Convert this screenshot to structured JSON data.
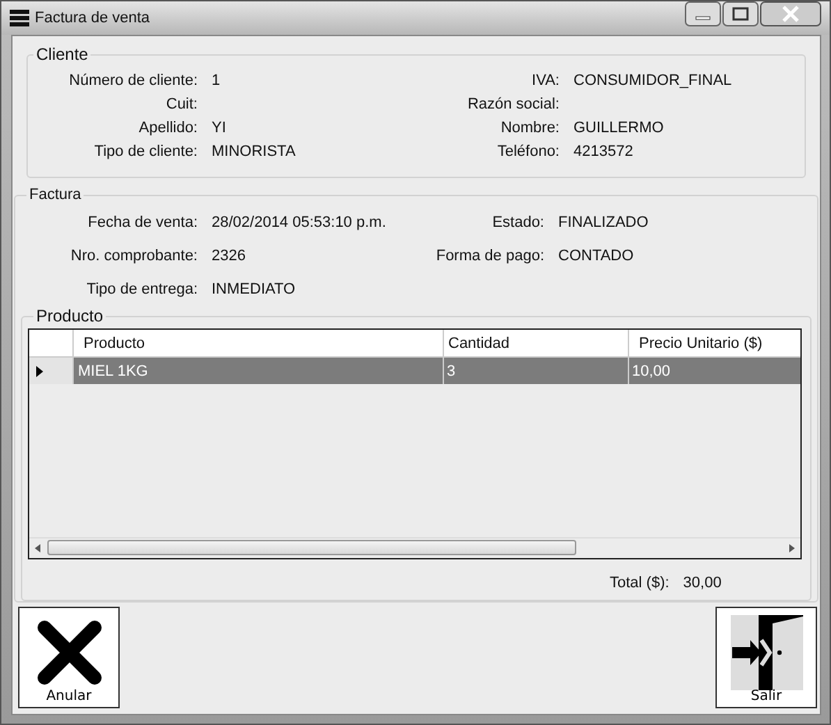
{
  "window": {
    "title": "Factura de venta"
  },
  "cliente": {
    "title": "Cliente",
    "left": [
      {
        "label": "Número de cliente:",
        "value": "1"
      },
      {
        "label": "Cuit:"
      },
      {
        "label": "Apellido:",
        "value": "YI"
      },
      {
        "label": "Tipo de cliente:",
        "value": "MINORISTA"
      }
    ],
    "right": [
      {
        "label": "IVA:",
        "value": "CONSUMIDOR_FINAL"
      },
      {
        "label": "Razón social:"
      },
      {
        "label": "Nombre:",
        "value": "GUILLERMO"
      },
      {
        "label": "Teléfono:",
        "value": "4213572"
      }
    ]
  },
  "factura": {
    "title": "Factura",
    "left": [
      {
        "label": "Fecha de venta:",
        "value": "28/02/2014 05:53:10 p.m."
      },
      {
        "label": "Nro. comprobante:",
        "value": "2326"
      },
      {
        "label": "Tipo de entrega:",
        "value": "INMEDIATO"
      }
    ],
    "right": [
      {
        "label": "Estado:",
        "value": "FINALIZADO"
      },
      {
        "label": "Forma de pago:",
        "value": "CONTADO"
      }
    ]
  },
  "producto": {
    "title": "Producto",
    "columns": [
      "Producto",
      "Cantidad",
      "Precio Unitario ($)"
    ],
    "rows": [
      {
        "selected": true,
        "cells": [
          "MIEL 1KG",
          "3",
          "10,00"
        ]
      }
    ]
  },
  "total": {
    "label": "Total ($):",
    "value": "30,00"
  },
  "buttons": [
    {
      "kind": "cancel",
      "label": "Anular"
    },
    {
      "kind": "exit",
      "label": "Salir"
    }
  ]
}
